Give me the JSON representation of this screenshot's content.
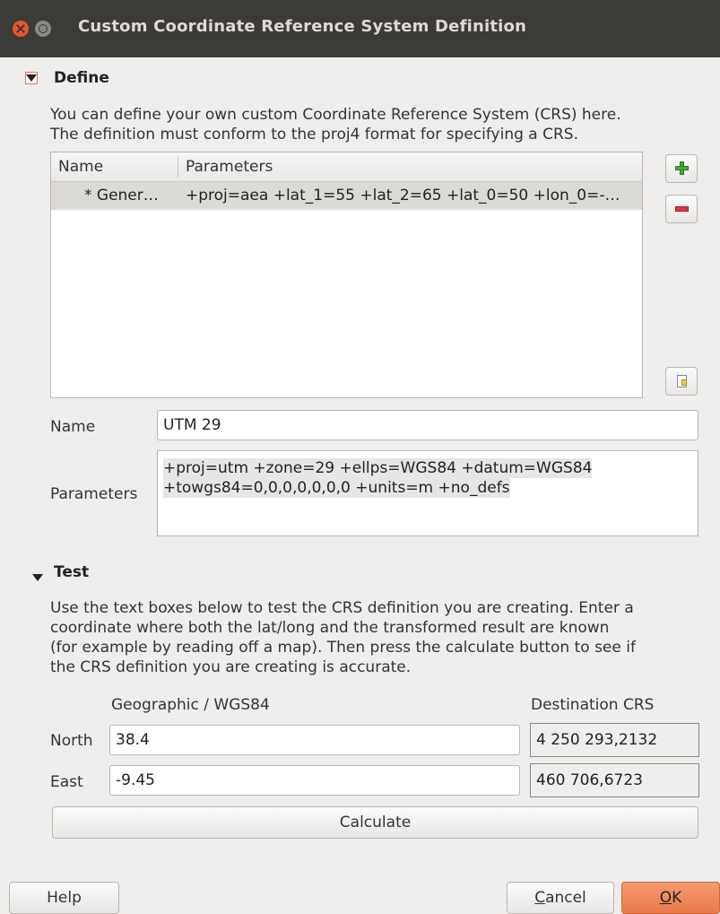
{
  "window": {
    "title": "Custom Coordinate Reference System Definition"
  },
  "define": {
    "title": "Define",
    "description_line1": "You can define your own custom Coordinate Reference System (CRS) here.",
    "description_line2": "The definition must conform to the proj4 format for specifying a CRS.",
    "table": {
      "columns": [
        "Name",
        "Parameters"
      ],
      "rows": [
        {
          "name": "* Gener…",
          "parameters": "+proj=aea +lat_1=55 +lat_2=65 +lat_0=50 +lon_0=-…"
        }
      ]
    },
    "name_label": "Name",
    "name_value": "UTM 29",
    "parameters_label": "Parameters",
    "parameters_line1": "+proj=utm +zone=29 +ellps=WGS84 +datum=WGS84",
    "parameters_line2": "+towgs84=0,0,0,0,0,0,0 +units=m +no_defs"
  },
  "test": {
    "title": "Test",
    "description_lines": [
      "Use the text boxes below to test the CRS definition you are creating. Enter a",
      "coordinate where both the lat/long and the transformed result are known",
      "(for example by reading off a map). Then press the calculate button to see if",
      "the CRS definition you are creating is accurate."
    ],
    "geographic_header": "Geographic / WGS84",
    "destination_header": "Destination CRS",
    "north_label": "North",
    "north_value": "38.4",
    "north_result": "4 250 293,2132",
    "east_label": "East",
    "east_value": "-9.45",
    "east_result": "460 706,6723",
    "calculate_label": "Calculate"
  },
  "buttons": {
    "help": "Help",
    "cancel_prefix": "C",
    "cancel_rest": "ancel",
    "ok_prefix": "O",
    "ok_rest": "K"
  },
  "icons": {
    "add": "plus-icon",
    "remove": "minus-icon",
    "copy": "copy-icon"
  },
  "colors": {
    "titlebar": "#3c3b37",
    "close_button": "#e8562a",
    "ok_button": "#ea7a49",
    "selected_row": "#dcdad7"
  }
}
